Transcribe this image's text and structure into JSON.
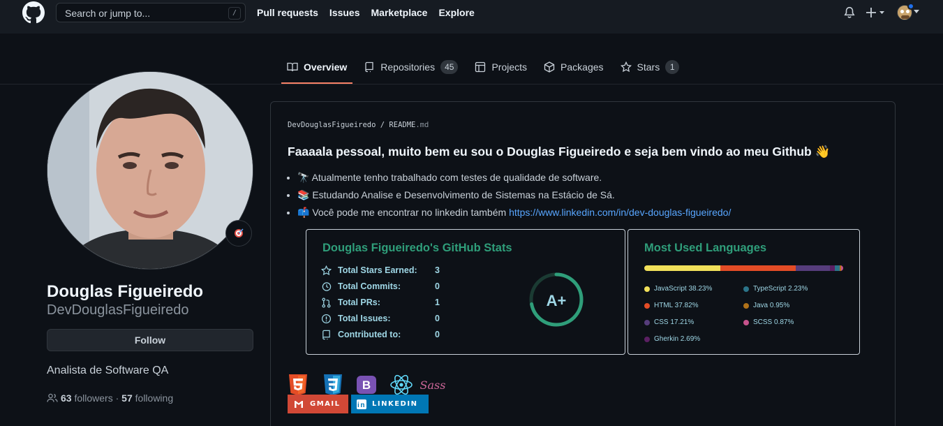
{
  "header": {
    "search_placeholder": "Search or jump to...",
    "search_shortcut": "/",
    "nav": [
      "Pull requests",
      "Issues",
      "Marketplace",
      "Explore"
    ]
  },
  "tabs": [
    {
      "label": "Overview",
      "active": true
    },
    {
      "label": "Repositories",
      "count": "45"
    },
    {
      "label": "Projects"
    },
    {
      "label": "Packages"
    },
    {
      "label": "Stars",
      "count": "1"
    }
  ],
  "profile": {
    "name": "Douglas Figueiredo",
    "username": "DevDouglasFigueiredo",
    "follow_label": "Follow",
    "bio": "Analista de Software QA",
    "followers": "63",
    "followers_label": "followers",
    "separator": "·",
    "following": "57",
    "following_label": "following"
  },
  "readme": {
    "owner": "DevDouglasFigueiredo",
    "sep": "/",
    "file": "README",
    "ext": ".md",
    "title": "Faaaala pessoal, muito bem eu sou o Douglas Figueiredo e seja bem vindo ao meu Github 👋",
    "bullets": [
      {
        "emoji": "🔭",
        "text": "Atualmente tenho trabalhado com testes de qualidade de software."
      },
      {
        "emoji": "📚",
        "text": "Estudando Analise e Desenvolvimento de Sistemas na Estácio de Sá."
      },
      {
        "emoji": "📫",
        "text": "Você pode me encontrar no linkedin também ",
        "link": "https://www.linkedin.com/in/dev-douglas-figueiredo/"
      }
    ]
  },
  "stats": {
    "title": "Douglas Figueiredo's GitHub Stats",
    "rows": [
      {
        "label": "Total Stars Earned:",
        "value": "3"
      },
      {
        "label": "Total Commits:",
        "value": "0"
      },
      {
        "label": "Total PRs:",
        "value": "1"
      },
      {
        "label": "Total Issues:",
        "value": "0"
      },
      {
        "label": "Contributed to:",
        "value": "0"
      }
    ],
    "grade": "A+",
    "grade_progress": 0.72
  },
  "languages": {
    "title": "Most Used Languages",
    "items": [
      {
        "label": "JavaScript 38.23%",
        "pct": 38.23,
        "color": "#f1e05a"
      },
      {
        "label": "HTML 37.82%",
        "pct": 37.82,
        "color": "#e34c26"
      },
      {
        "label": "CSS 17.21%",
        "pct": 17.21,
        "color": "#563d7c"
      },
      {
        "label": "Gherkin 2.69%",
        "pct": 2.69,
        "color": "#5B2063"
      },
      {
        "label": "TypeScript 2.23%",
        "pct": 2.23,
        "color": "#2b7489"
      },
      {
        "label": "Java 0.95%",
        "pct": 0.95,
        "color": "#b07219"
      },
      {
        "label": "SCSS 0.87%",
        "pct": 0.87,
        "color": "#c6538c"
      }
    ]
  },
  "badges": {
    "tech_icons": [
      "html5-icon",
      "css3-icon",
      "bootstrap-icon",
      "react-icon",
      "sass-icon"
    ],
    "bootstrap_letter": "B",
    "sass_word": "Sass",
    "gmail_label": "GMAIL",
    "linkedin_label": "LINKEDIN",
    "linkedin_logo_text": "in"
  },
  "colors": {
    "accent_tab": "#f78166",
    "card_title": "#2f9e7a",
    "stat_text": "#9fd7e6",
    "gmail": "#D14836",
    "linkedin": "#0077B5"
  }
}
